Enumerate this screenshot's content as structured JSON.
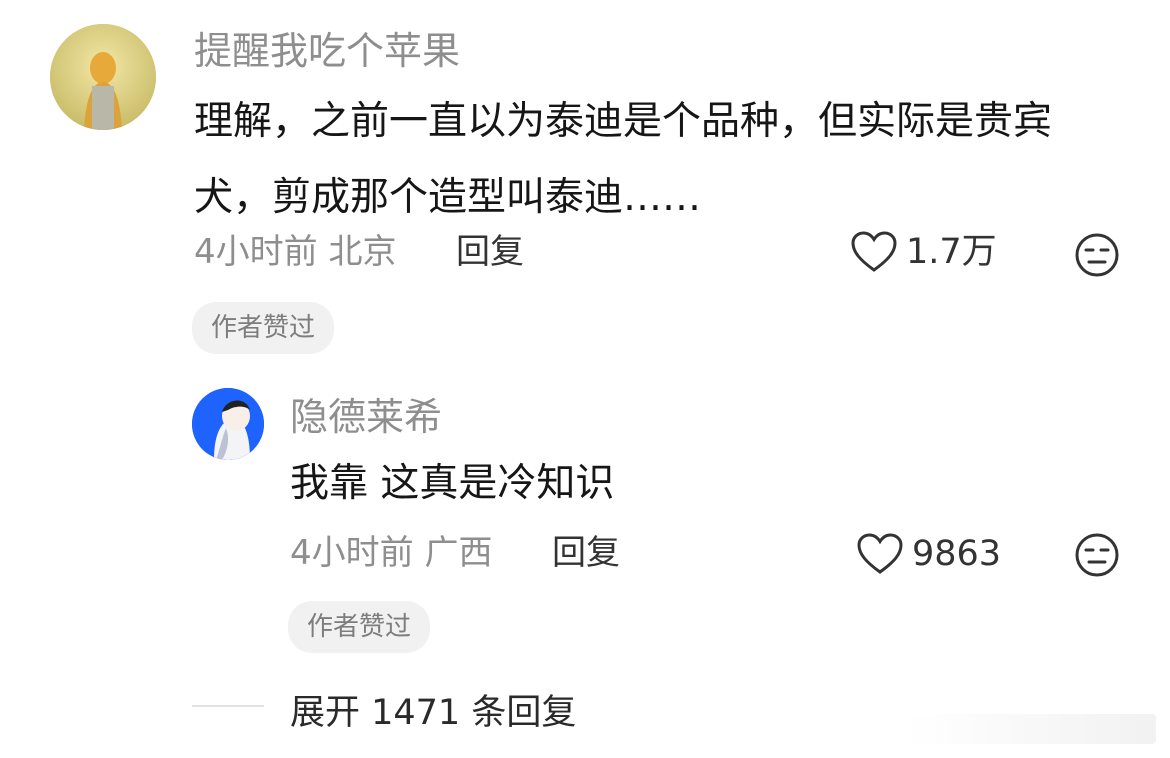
{
  "comment": {
    "author": "提醒我吃个苹果",
    "text_line1": "理解，之前一直以为泰迪是个品种，但实际是贵宾",
    "text_line2": "犬，剪成那个造型叫泰迪……",
    "time_location": "4小时前 北京",
    "reply_label": "回复",
    "like_count": "1.7万",
    "badge": "作者赞过",
    "icons": {
      "like": "heart-outline-icon",
      "dislike": "neutral-face-icon"
    }
  },
  "reply": {
    "author": "隐德莱希",
    "text": "我靠 这真是冷知识",
    "time_location": "4小时前 广西",
    "reply_label": "回复",
    "like_count": "9863",
    "badge": "作者赞过",
    "icons": {
      "like": "heart-outline-icon",
      "dislike": "neutral-face-icon"
    }
  },
  "expand_replies": "展开 1471 条回复",
  "colors": {
    "meta_gray": "#8e8e8e",
    "badge_bg": "#f1f1f1",
    "reply_avatar_bg": "#1f63ff"
  }
}
